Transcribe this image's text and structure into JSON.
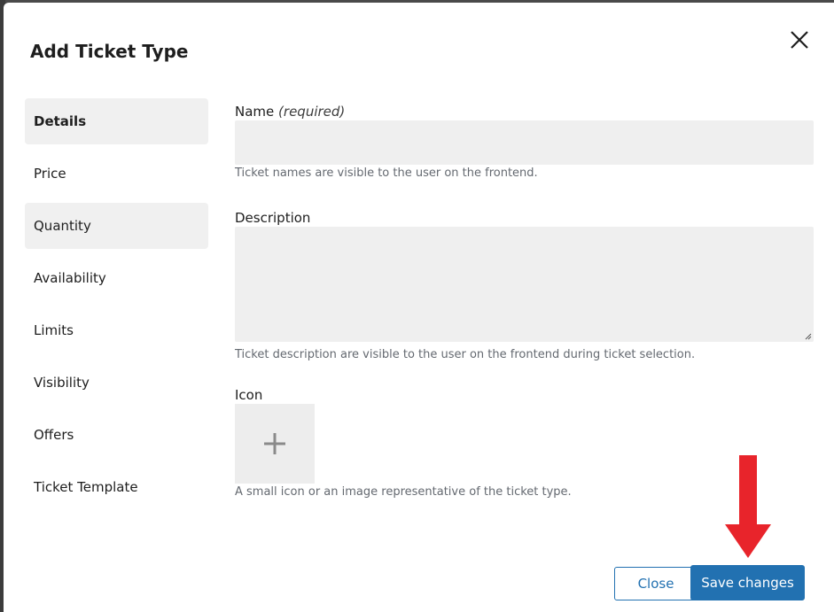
{
  "modal": {
    "title": "Add Ticket Type"
  },
  "nav": {
    "items": [
      {
        "label": "Details"
      },
      {
        "label": "Price"
      },
      {
        "label": "Quantity"
      },
      {
        "label": "Availability"
      },
      {
        "label": "Limits"
      },
      {
        "label": "Visibility"
      },
      {
        "label": "Offers"
      },
      {
        "label": "Ticket Template"
      }
    ]
  },
  "form": {
    "name": {
      "label": "Name",
      "required_note": "(required)",
      "value": "",
      "help": "Ticket names are visible to the user on the frontend."
    },
    "description": {
      "label": "Description",
      "value": "",
      "help": "Ticket description are visible to the user on the frontend during ticket selection."
    },
    "icon": {
      "label": "Icon",
      "help": "A small icon or an image representative of the ticket type.",
      "add_icon": "plus-icon"
    }
  },
  "footer": {
    "close_label": "Close",
    "save_label": "Save changes"
  },
  "annotation": {
    "arrow_color": "#e8242b",
    "arrow_icon": "down-arrow-icon"
  },
  "colors": {
    "accent": "#2271b1",
    "field_bg": "#efefef",
    "nav_active_bg": "#f0f0f0"
  }
}
